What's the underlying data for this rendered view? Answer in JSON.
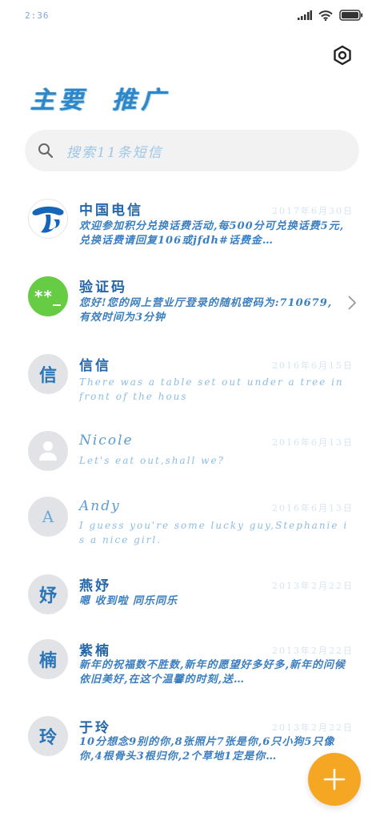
{
  "status": {
    "time": "2:36"
  },
  "header": {
    "title": "主要  推广",
    "settings_icon": "gear-icon"
  },
  "search": {
    "placeholder": "搜索11条短信",
    "icon": "search-icon"
  },
  "messages": [
    {
      "sender": "中国电信",
      "date": "2017年6月30日",
      "preview": "欢迎参加积分兑换话费活动,每500分可兑换话费5元,兑换话费请回复106或jfdh#话费金…",
      "avatar": "china-telecom-logo"
    },
    {
      "sender": "验证码",
      "date": "",
      "preview": "您好!您的网上营业厅登录的随机密码为:710679,有效时间为3分钟",
      "avatar_text": "**_",
      "has_chevron": true
    },
    {
      "sender": "信信",
      "date": "2016年6月15日",
      "preview": "There was a table set out under a tree in front of the hous",
      "avatar_text": "信"
    },
    {
      "sender": "Nicole",
      "date": "2016年6月13日",
      "preview": "Let's eat out,shall we?",
      "avatar": "person-icon"
    },
    {
      "sender": "Andy",
      "date": "2016年6月13日",
      "preview": "I guess you're some lucky guy,Stephanie is a nice girl.",
      "avatar_text": "A"
    },
    {
      "sender": "燕妤",
      "date": "2013年2月22日",
      "preview": "嗯 收到啦 同乐同乐",
      "avatar_text": "妤"
    },
    {
      "sender": "紫楠",
      "date": "2013年2月22日",
      "preview": "新年的祝福数不胜数,新年的愿望好多好多,新年的问候依旧美好,在这个温馨的时刻,送…",
      "avatar_text": "楠"
    },
    {
      "sender": "于玲",
      "date": "2013年2月22日",
      "preview": "10分想念9别的你,8张照片7张是你,6只小狗5只像你,4根骨头3根归你,2个草地1定是你…",
      "avatar_text": "玲"
    }
  ],
  "fab": {
    "icon": "plus-icon"
  },
  "colors": {
    "fab": "#f5a623",
    "avatar_green": "#66cc44",
    "accent_blue": "#2466a8"
  }
}
